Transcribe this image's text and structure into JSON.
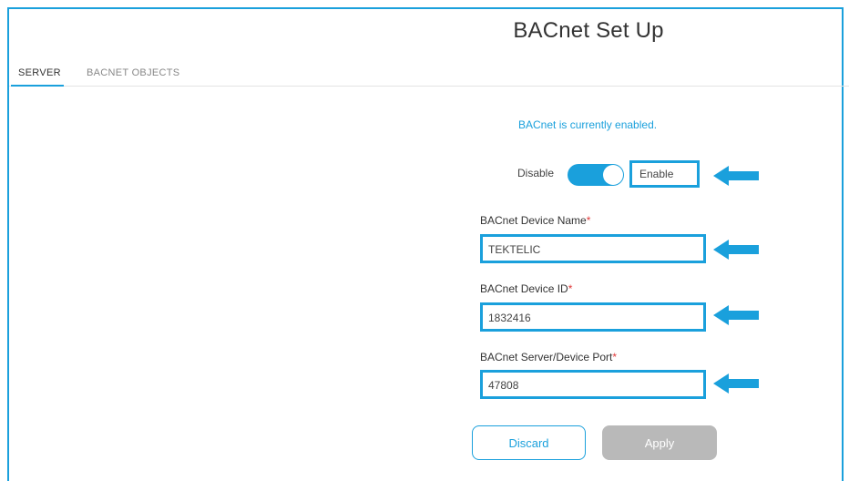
{
  "page": {
    "title": "BACnet Set Up"
  },
  "tabs": [
    {
      "label": "SERVER",
      "active": true
    },
    {
      "label": "BACNET OBJECTS",
      "active": false
    }
  ],
  "status": {
    "message": "BACnet is currently enabled."
  },
  "toggle": {
    "off_label": "Disable",
    "on_label": "Enable",
    "state": "on"
  },
  "fields": {
    "device_name": {
      "label": "BACnet Device Name",
      "required_mark": "*",
      "value": "TEKTELIC"
    },
    "device_id": {
      "label": "BACnet Device ID",
      "required_mark": "*",
      "value": "1832416"
    },
    "port": {
      "label": "BACnet Server/Device Port",
      "required_mark": "*",
      "value": "47808"
    }
  },
  "buttons": {
    "discard": "Discard",
    "apply": "Apply"
  },
  "colors": {
    "accent": "#1aa0dc",
    "required": "#e03a3a",
    "disabled_button": "#b9b9b9"
  },
  "icons": {
    "highlight_arrow": "left-arrow-icon"
  }
}
